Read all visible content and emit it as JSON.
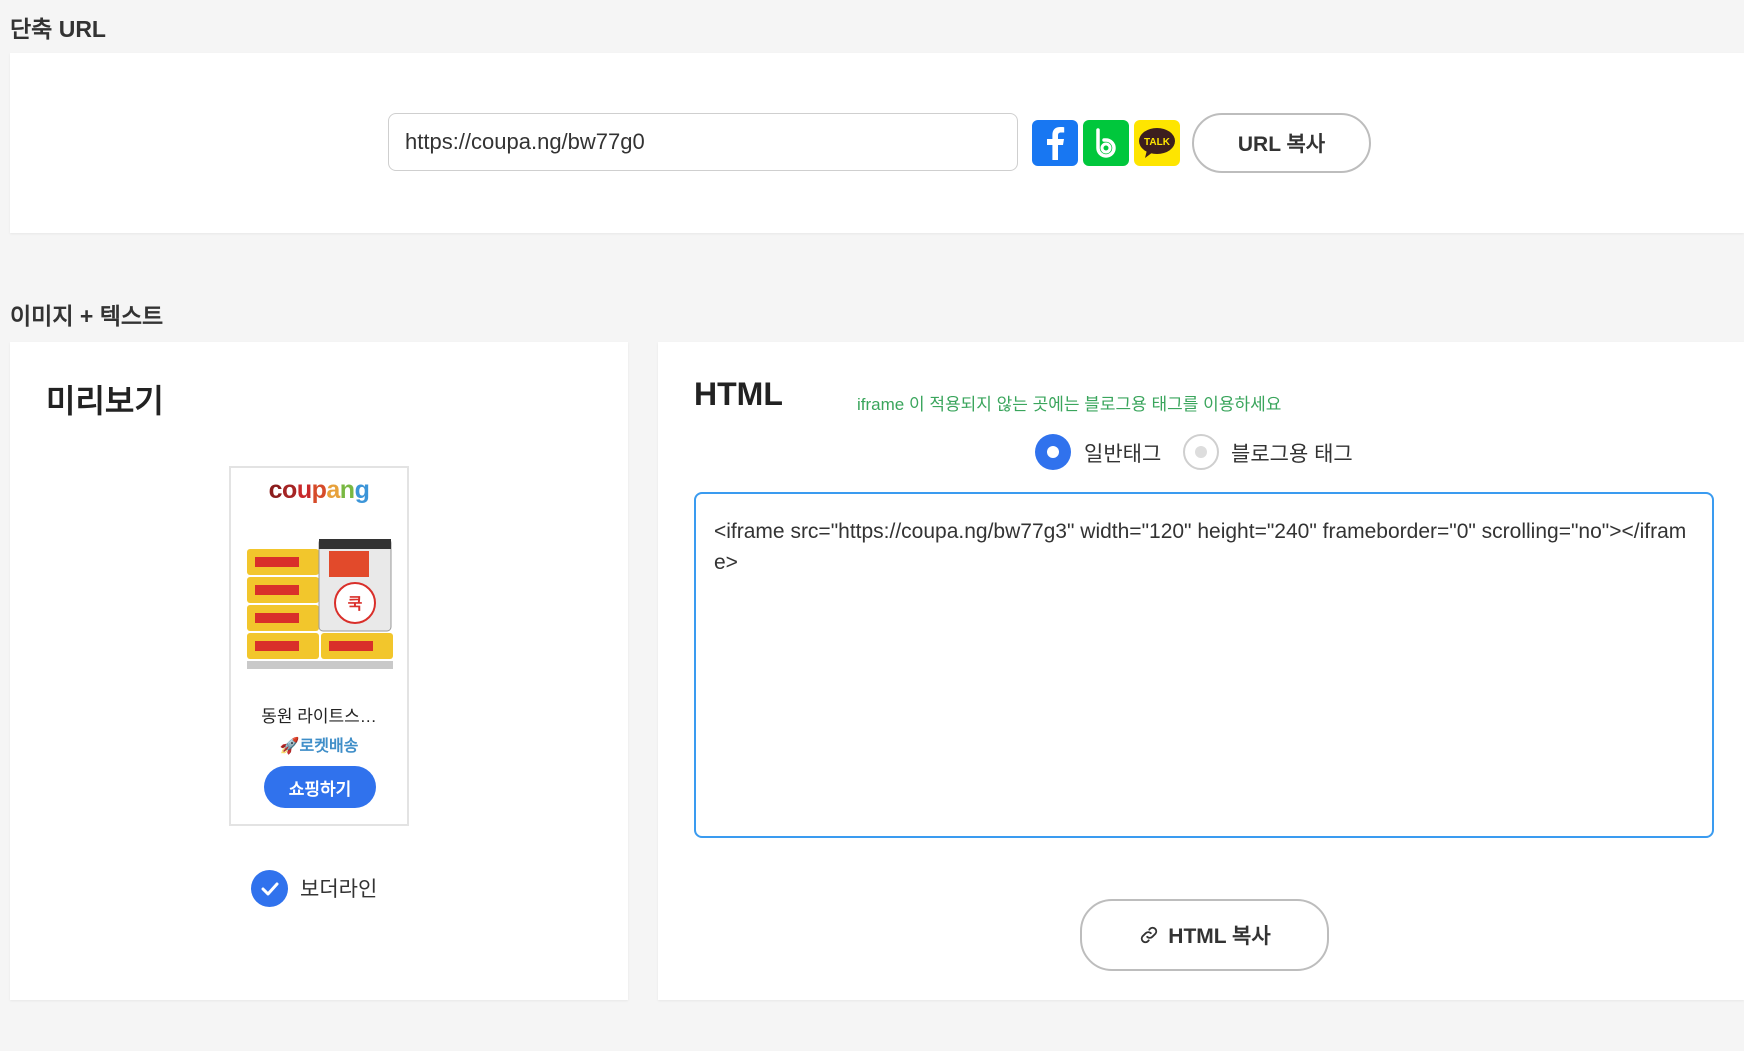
{
  "short_url": {
    "section_title": "단축 URL",
    "url_value": "https://coupa.ng/bw77g0",
    "copy_button": "URL 복사",
    "share": {
      "facebook_icon": "facebook-icon",
      "band_icon": "band-icon",
      "kakao_label": "TALK",
      "kakao_color": "#fee500",
      "facebook_color": "#1877f2",
      "band_color": "#00c73c"
    }
  },
  "image_text": {
    "section_title": "이미지 + 텍스트",
    "preview": {
      "title": "미리보기",
      "widget": {
        "logo": "coupang",
        "product_name": "동원 라이트스…",
        "rocket_label": "🚀로켓배송",
        "shop_button": "쇼핑하기"
      },
      "border_line_label": "보더라인",
      "border_line_checked": true
    },
    "html": {
      "title": "HTML",
      "hint": "iframe 이 적용되지 않는 곳에는 블로그용 태그를 이용하세요",
      "options": [
        {
          "label": "일반태그",
          "selected": true
        },
        {
          "label": "블로그용 태그",
          "selected": false
        }
      ],
      "code": "<iframe src=\"https://coupa.ng/bw77g3\" width=\"120\" height=\"240\" frameborder=\"0\" scrolling=\"no\"></iframe>",
      "copy_button": "HTML 복사"
    }
  },
  "colors": {
    "primary_blue": "#3072ed",
    "hint_green": "#3aa55c",
    "code_border": "#3a9bf0"
  }
}
